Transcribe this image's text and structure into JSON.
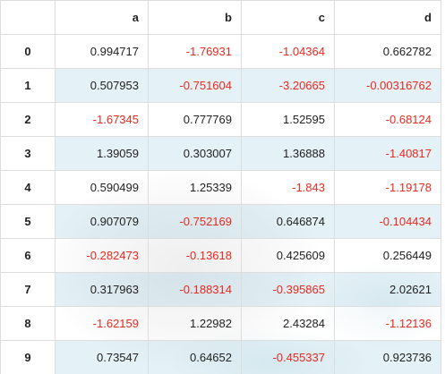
{
  "table": {
    "columns": [
      "a",
      "b",
      "c",
      "d"
    ],
    "rows": [
      {
        "index": "0",
        "values": [
          "0.994717",
          "-1.76931",
          "-1.04364",
          "0.662782"
        ]
      },
      {
        "index": "1",
        "values": [
          "0.507953",
          "-0.751604",
          "-3.20665",
          "-0.00316762"
        ]
      },
      {
        "index": "2",
        "values": [
          "-1.67345",
          "0.777769",
          "1.52595",
          "-0.68124"
        ]
      },
      {
        "index": "3",
        "values": [
          "1.39059",
          "0.303007",
          "1.36888",
          "-1.40817"
        ]
      },
      {
        "index": "4",
        "values": [
          "0.590499",
          "1.25339",
          "-1.843",
          "-1.19178"
        ]
      },
      {
        "index": "5",
        "values": [
          "0.907079",
          "-0.752169",
          "0.646874",
          "-0.104434"
        ]
      },
      {
        "index": "6",
        "values": [
          "-0.282473",
          "-0.13618",
          "0.425609",
          "0.256449"
        ]
      },
      {
        "index": "7",
        "values": [
          "0.317963",
          "-0.188314",
          "-0.395865",
          "2.02621"
        ]
      },
      {
        "index": "8",
        "values": [
          "-1.62159",
          "1.22982",
          "2.43284",
          "-1.12136"
        ]
      },
      {
        "index": "9",
        "values": [
          "0.73547",
          "0.64652",
          "-0.455337",
          "0.923736"
        ]
      }
    ]
  },
  "colors": {
    "negative": "#e8291f",
    "positive": "#222222",
    "stripe": "#d2e8f0",
    "border": "#dddddd"
  }
}
